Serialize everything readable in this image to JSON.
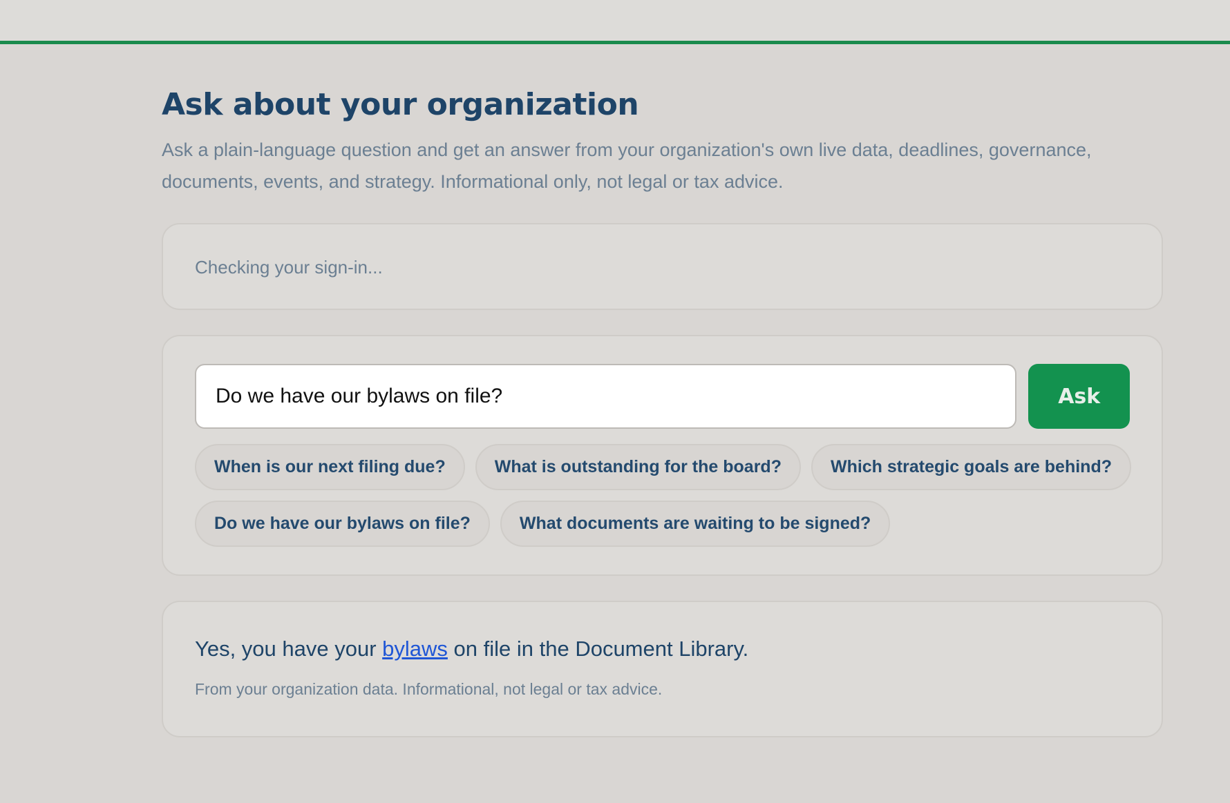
{
  "header": {
    "title": "Ask about your organization",
    "subtitle": "Ask a plain-language question and get an answer from your organization's own live data, deadlines, governance, documents, events, and strategy. Informational only, not legal or tax advice."
  },
  "status": {
    "signin_text": "Checking your sign-in..."
  },
  "ask": {
    "input_value": "Do we have our bylaws on file?",
    "button_label": "Ask",
    "suggestions": [
      "When is our next filing due?",
      "What is outstanding for the board?",
      "Which strategic goals are behind?",
      "Do we have our bylaws on file?",
      "What documents are waiting to be signed?"
    ]
  },
  "answer": {
    "text_before": "Yes, you have your ",
    "link_text": "bylaws",
    "text_after": " on file in the Document Library.",
    "note": "From your organization data. Informational, not legal or tax advice."
  },
  "colors": {
    "accent": "#1a8a4c",
    "button": "#13924f",
    "title": "#1e4468",
    "link": "#1f56d6"
  }
}
